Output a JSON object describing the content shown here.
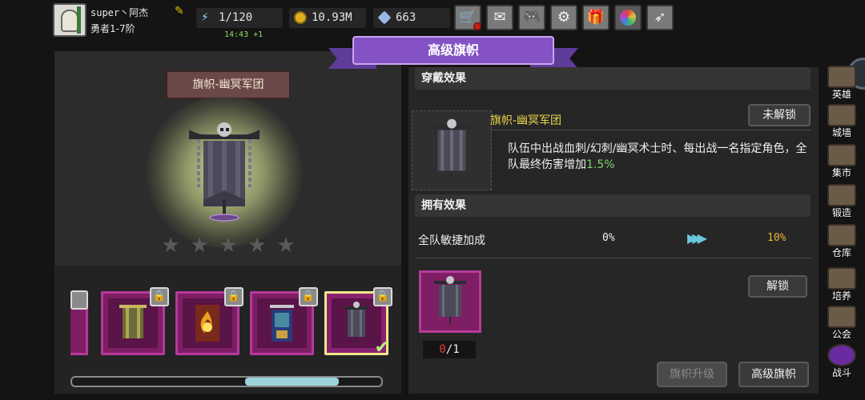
{
  "user": {
    "name": "super丶阿杰",
    "rank": "勇者1-7阶"
  },
  "resources": {
    "energy": "1/120",
    "energy_timer": "14:43 +1",
    "gold": "10.93M",
    "gems": "663"
  },
  "toolbar_icons": [
    "shop-cart-icon",
    "mail-icon",
    "gamepad-icon",
    "gear-icon",
    "gift-icon",
    "spin-wheel-icon",
    "feather-icon"
  ],
  "header": {
    "title": "高级旗帜"
  },
  "banner": {
    "name": "旗帜-幽冥军团",
    "stars_filled": 0,
    "stars_total": 5
  },
  "collection": {
    "slots": [
      {
        "name": "banner-slot-gold",
        "locked": true,
        "selected": false
      },
      {
        "name": "banner-slot-fire",
        "locked": true,
        "selected": false
      },
      {
        "name": "banner-slot-knight",
        "locked": true,
        "selected": false
      },
      {
        "name": "banner-slot-nether",
        "locked": true,
        "selected": true
      }
    ],
    "scroll_position": 0.55
  },
  "wear": {
    "section_title": "穿戴效果",
    "item_name": "旗帜-幽冥军团",
    "status_button": "未解锁",
    "desc_text": "队伍中出战血刺/幻刺/幽冥术士时、每出战一名指定角色，全队最终伤害增加",
    "desc_value": "1.5%"
  },
  "own": {
    "section_title": "拥有效果",
    "stat_label": "全队敏捷加成",
    "stat_from": "0%",
    "stat_to": "10%",
    "unlock_button": "解锁",
    "count_have": "0",
    "count_need": "/1"
  },
  "bottom_buttons": {
    "upgrade": "旗帜升级",
    "senior": "高级旗帜"
  },
  "side_nav": [
    {
      "label": "英雄",
      "icon": "hero-icon"
    },
    {
      "label": "城墙",
      "icon": "wall-icon"
    },
    {
      "label": "集市",
      "icon": "market-icon"
    },
    {
      "label": "锻造",
      "icon": "anvil-icon"
    },
    {
      "label": "仓库",
      "icon": "warehouse-icon"
    },
    {
      "label": "培养",
      "icon": "training-icon"
    },
    {
      "label": "公会",
      "icon": "guild-icon"
    },
    {
      "label": "战斗",
      "icon": "battle-portal-icon"
    }
  ],
  "colors": {
    "accent_purple": "#8452c4",
    "slot_magenta": "#7e1e64",
    "highlight_green": "#7fd66a",
    "gold_text": "#e8b830"
  }
}
